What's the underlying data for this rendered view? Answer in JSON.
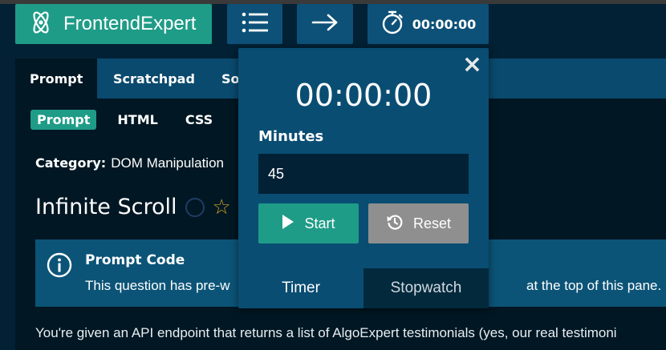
{
  "header": {
    "brand": "FrontendExpert",
    "timer": "00:00:00",
    "icons": {
      "brand": "atom-icon",
      "menu": "list-icon",
      "next": "arrow-right-icon",
      "timer": "stopwatch-icon"
    }
  },
  "tabs": [
    "Prompt",
    "Scratchpad",
    "So"
  ],
  "subtabs": [
    "Prompt",
    "HTML",
    "CSS"
  ],
  "category": {
    "label": "Category:",
    "value": "DOM Manipulation"
  },
  "question": {
    "title": "Infinite Scroll"
  },
  "infobox": {
    "title": "Prompt Code",
    "text_left": "This question has pre-w",
    "text_right": "at the top of this pane."
  },
  "description": "You're given an API endpoint that returns a list of AlgoExpert testimonials (yes, our real testimoni",
  "timer_popup": {
    "close": "×",
    "display": "00:00:00",
    "minutes_label": "Minutes",
    "minutes_value": "45",
    "start_label": "Start",
    "reset_label": "Reset",
    "tabs": [
      "Timer",
      "Stopwatch"
    ]
  },
  "colors": {
    "accent": "#1f9c87",
    "header_button": "#0d5178",
    "background": "#022135",
    "info_box": "#0c5477",
    "reset_button": "#8f8f8f",
    "star": "#c9a227"
  }
}
